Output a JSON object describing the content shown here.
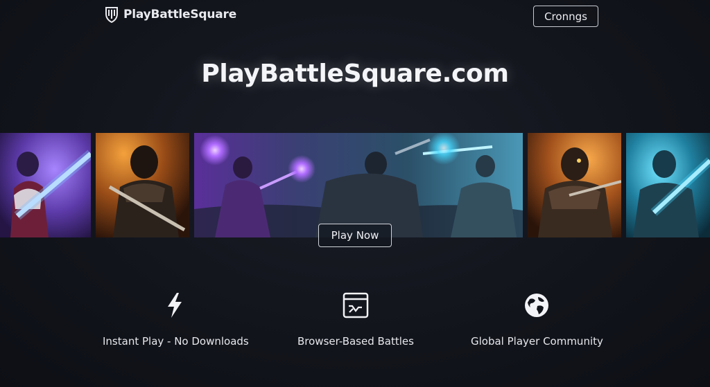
{
  "header": {
    "brand": "PlayBattleSquare",
    "button_label": "Cronngs"
  },
  "hero": {
    "title": "PlayBattleSquare.com",
    "play_button_label": "Play Now"
  },
  "gallery": {
    "panels": [
      {
        "name": "mage-panel-left",
        "theme": "purple"
      },
      {
        "name": "warrior-panel-left",
        "theme": "orange"
      },
      {
        "name": "battle-banner",
        "theme": "purple-teal"
      },
      {
        "name": "knight-panel-right",
        "theme": "orange"
      },
      {
        "name": "swordsman-panel-right",
        "theme": "cyan"
      }
    ]
  },
  "features": [
    {
      "icon": "lightning-icon",
      "label": "Instant Play - No Downloads"
    },
    {
      "icon": "browser-window-icon",
      "label": "Browser-Based Battles"
    },
    {
      "icon": "globe-icon",
      "label": "Global Player Community"
    }
  ],
  "colors": {
    "background": "#12141b",
    "purple_glow": "#b06cff",
    "orange_glow": "#e98a2c",
    "cyan_glow": "#46d8ff"
  }
}
